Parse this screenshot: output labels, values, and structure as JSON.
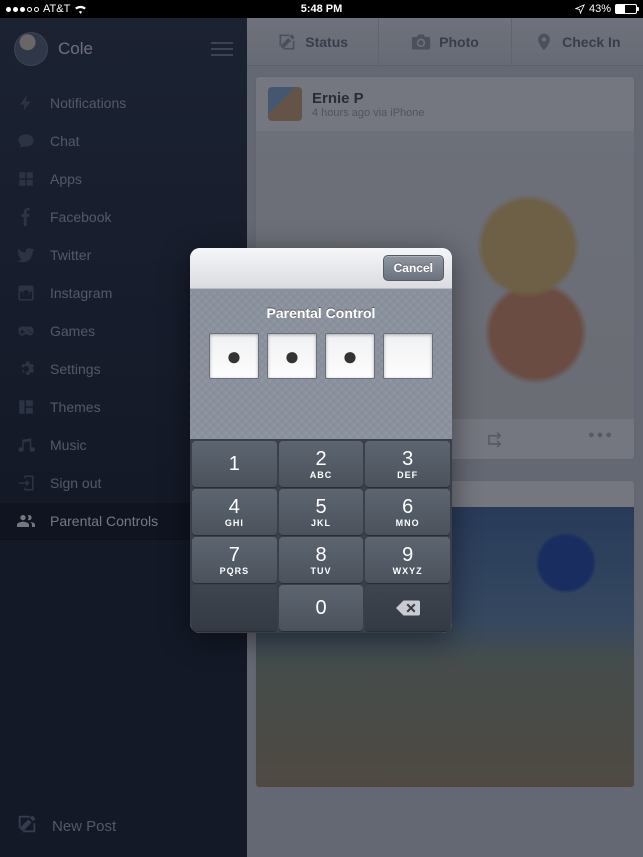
{
  "status_bar": {
    "carrier": "AT&T",
    "time": "5:48 PM",
    "battery_pct": "43%"
  },
  "sidebar": {
    "user_name": "Cole",
    "items": [
      {
        "label": "Notifications"
      },
      {
        "label": "Chat"
      },
      {
        "label": "Apps"
      },
      {
        "label": "Facebook"
      },
      {
        "label": "Twitter"
      },
      {
        "label": "Instagram"
      },
      {
        "label": "Games"
      },
      {
        "label": "Settings"
      },
      {
        "label": "Themes"
      },
      {
        "label": "Music"
      },
      {
        "label": "Sign out"
      },
      {
        "label": "Parental Controls"
      }
    ],
    "new_post": "New Post"
  },
  "compose": {
    "status": "Status",
    "photo": "Photo",
    "checkin": "Check In"
  },
  "post": {
    "author": "Ernie P",
    "meta": "4 hours ago via iPhone"
  },
  "modal": {
    "cancel": "Cancel",
    "title": "Parental Control",
    "pin": [
      "●",
      "●",
      "●",
      ""
    ],
    "keypad": [
      [
        {
          "num": "1",
          "let": ""
        },
        {
          "num": "2",
          "let": "ABC"
        },
        {
          "num": "3",
          "let": "DEF"
        }
      ],
      [
        {
          "num": "4",
          "let": "GHI"
        },
        {
          "num": "5",
          "let": "JKL"
        },
        {
          "num": "6",
          "let": "MNO"
        }
      ],
      [
        {
          "num": "7",
          "let": "PQRS"
        },
        {
          "num": "8",
          "let": "TUV"
        },
        {
          "num": "9",
          "let": "WXYZ"
        }
      ]
    ],
    "zero": "0"
  }
}
